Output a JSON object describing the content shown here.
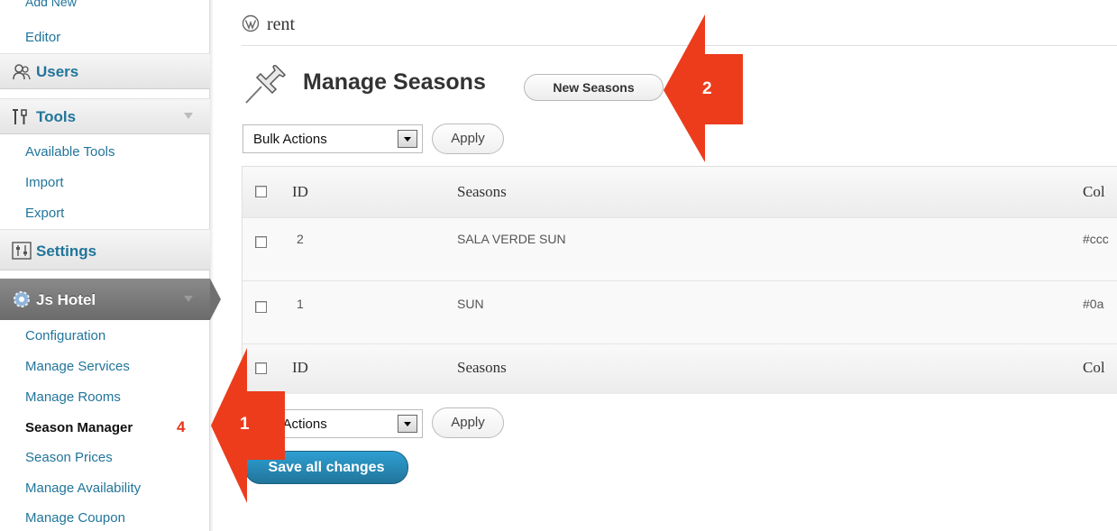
{
  "sidebar": {
    "cutoff_label": "Add New",
    "editor_label": "Editor",
    "users_label": "Users",
    "tools_label": "Tools",
    "tools_items": [
      "Available Tools",
      "Import",
      "Export"
    ],
    "settings_label": "Settings",
    "jshotel_label": "Js Hotel",
    "jshotel_items": [
      "Configuration",
      "Manage Services",
      "Manage Rooms",
      "Season Manager",
      "Season Prices",
      "Manage Availability",
      "Manage Coupon"
    ],
    "marker4": "4"
  },
  "header": {
    "site_title": "rent",
    "page_title": "Manage Seasons",
    "new_button": "New Seasons"
  },
  "bulk_top": {
    "select_value": "Bulk Actions",
    "apply_label": "Apply"
  },
  "bulk_bottom": {
    "select_value": "Bulk Actions",
    "apply_label": "Apply"
  },
  "table": {
    "columns": [
      "ID",
      "Seasons",
      "Col"
    ],
    "rows": [
      {
        "id": "2",
        "season": "SALA VERDE SUN",
        "color": "#ccc"
      },
      {
        "id": "1",
        "season": "SUN",
        "color": "#0a"
      }
    ]
  },
  "save_button": "Save all changes",
  "annotations": [
    "1",
    "2"
  ],
  "colors": {
    "link": "#21759b",
    "annotation": "#e8351a",
    "primary_button": "#21759b"
  }
}
